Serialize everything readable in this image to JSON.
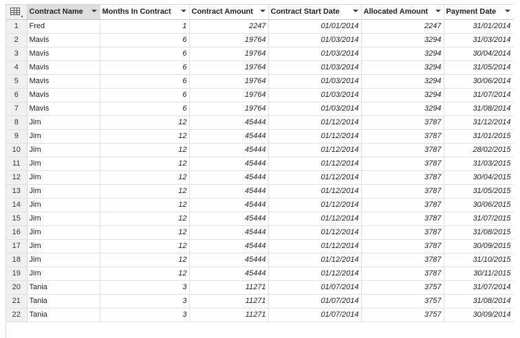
{
  "columns": [
    {
      "label": "Contract Name",
      "align": "left",
      "selected": true
    },
    {
      "label": "Months In Contract",
      "align": "right"
    },
    {
      "label": "Contract Amount",
      "align": "right"
    },
    {
      "label": "Contract Start Date",
      "align": "right"
    },
    {
      "label": "Allocated Amount",
      "align": "right"
    },
    {
      "label": "Payment Date",
      "align": "right"
    }
  ],
  "rows": [
    [
      "1",
      "Fred",
      "1",
      "2247",
      "01/01/2014",
      "2247",
      "31/01/2014"
    ],
    [
      "2",
      "Mavis",
      "6",
      "19764",
      "01/03/2014",
      "3294",
      "31/03/2014"
    ],
    [
      "3",
      "Mavis",
      "6",
      "19764",
      "01/03/2014",
      "3294",
      "30/04/2014"
    ],
    [
      "4",
      "Mavis",
      "6",
      "19764",
      "01/03/2014",
      "3294",
      "31/05/2014"
    ],
    [
      "5",
      "Mavis",
      "6",
      "19764",
      "01/03/2014",
      "3294",
      "30/06/2014"
    ],
    [
      "6",
      "Mavis",
      "6",
      "19764",
      "01/03/2014",
      "3294",
      "31/07/2014"
    ],
    [
      "7",
      "Mavis",
      "6",
      "19764",
      "01/03/2014",
      "3294",
      "31/08/2014"
    ],
    [
      "8",
      "Jim",
      "12",
      "45444",
      "01/12/2014",
      "3787",
      "31/12/2014"
    ],
    [
      "9",
      "Jim",
      "12",
      "45444",
      "01/12/2014",
      "3787",
      "31/01/2015"
    ],
    [
      "10",
      "Jim",
      "12",
      "45444",
      "01/12/2014",
      "3787",
      "28/02/2015"
    ],
    [
      "11",
      "Jim",
      "12",
      "45444",
      "01/12/2014",
      "3787",
      "31/03/2015"
    ],
    [
      "12",
      "Jim",
      "12",
      "45444",
      "01/12/2014",
      "3787",
      "30/04/2015"
    ],
    [
      "13",
      "Jim",
      "12",
      "45444",
      "01/12/2014",
      "3787",
      "31/05/2015"
    ],
    [
      "14",
      "Jim",
      "12",
      "45444",
      "01/12/2014",
      "3787",
      "30/06/2015"
    ],
    [
      "15",
      "Jim",
      "12",
      "45444",
      "01/12/2014",
      "3787",
      "31/07/2015"
    ],
    [
      "16",
      "Jim",
      "12",
      "45444",
      "01/12/2014",
      "3787",
      "31/08/2015"
    ],
    [
      "17",
      "Jim",
      "12",
      "45444",
      "01/12/2014",
      "3787",
      "30/09/2015"
    ],
    [
      "18",
      "Jim",
      "12",
      "45444",
      "01/12/2014",
      "3787",
      "31/10/2015"
    ],
    [
      "19",
      "Jim",
      "12",
      "45444",
      "01/12/2014",
      "3787",
      "30/11/2015"
    ],
    [
      "20",
      "Tania",
      "3",
      "11271",
      "01/07/2014",
      "3757",
      "31/07/2014"
    ],
    [
      "21",
      "Tania",
      "3",
      "11271",
      "01/07/2014",
      "3757",
      "31/08/2014"
    ],
    [
      "22",
      "Tania",
      "3",
      "11271",
      "01/07/2014",
      "3757",
      "30/09/2014"
    ]
  ]
}
